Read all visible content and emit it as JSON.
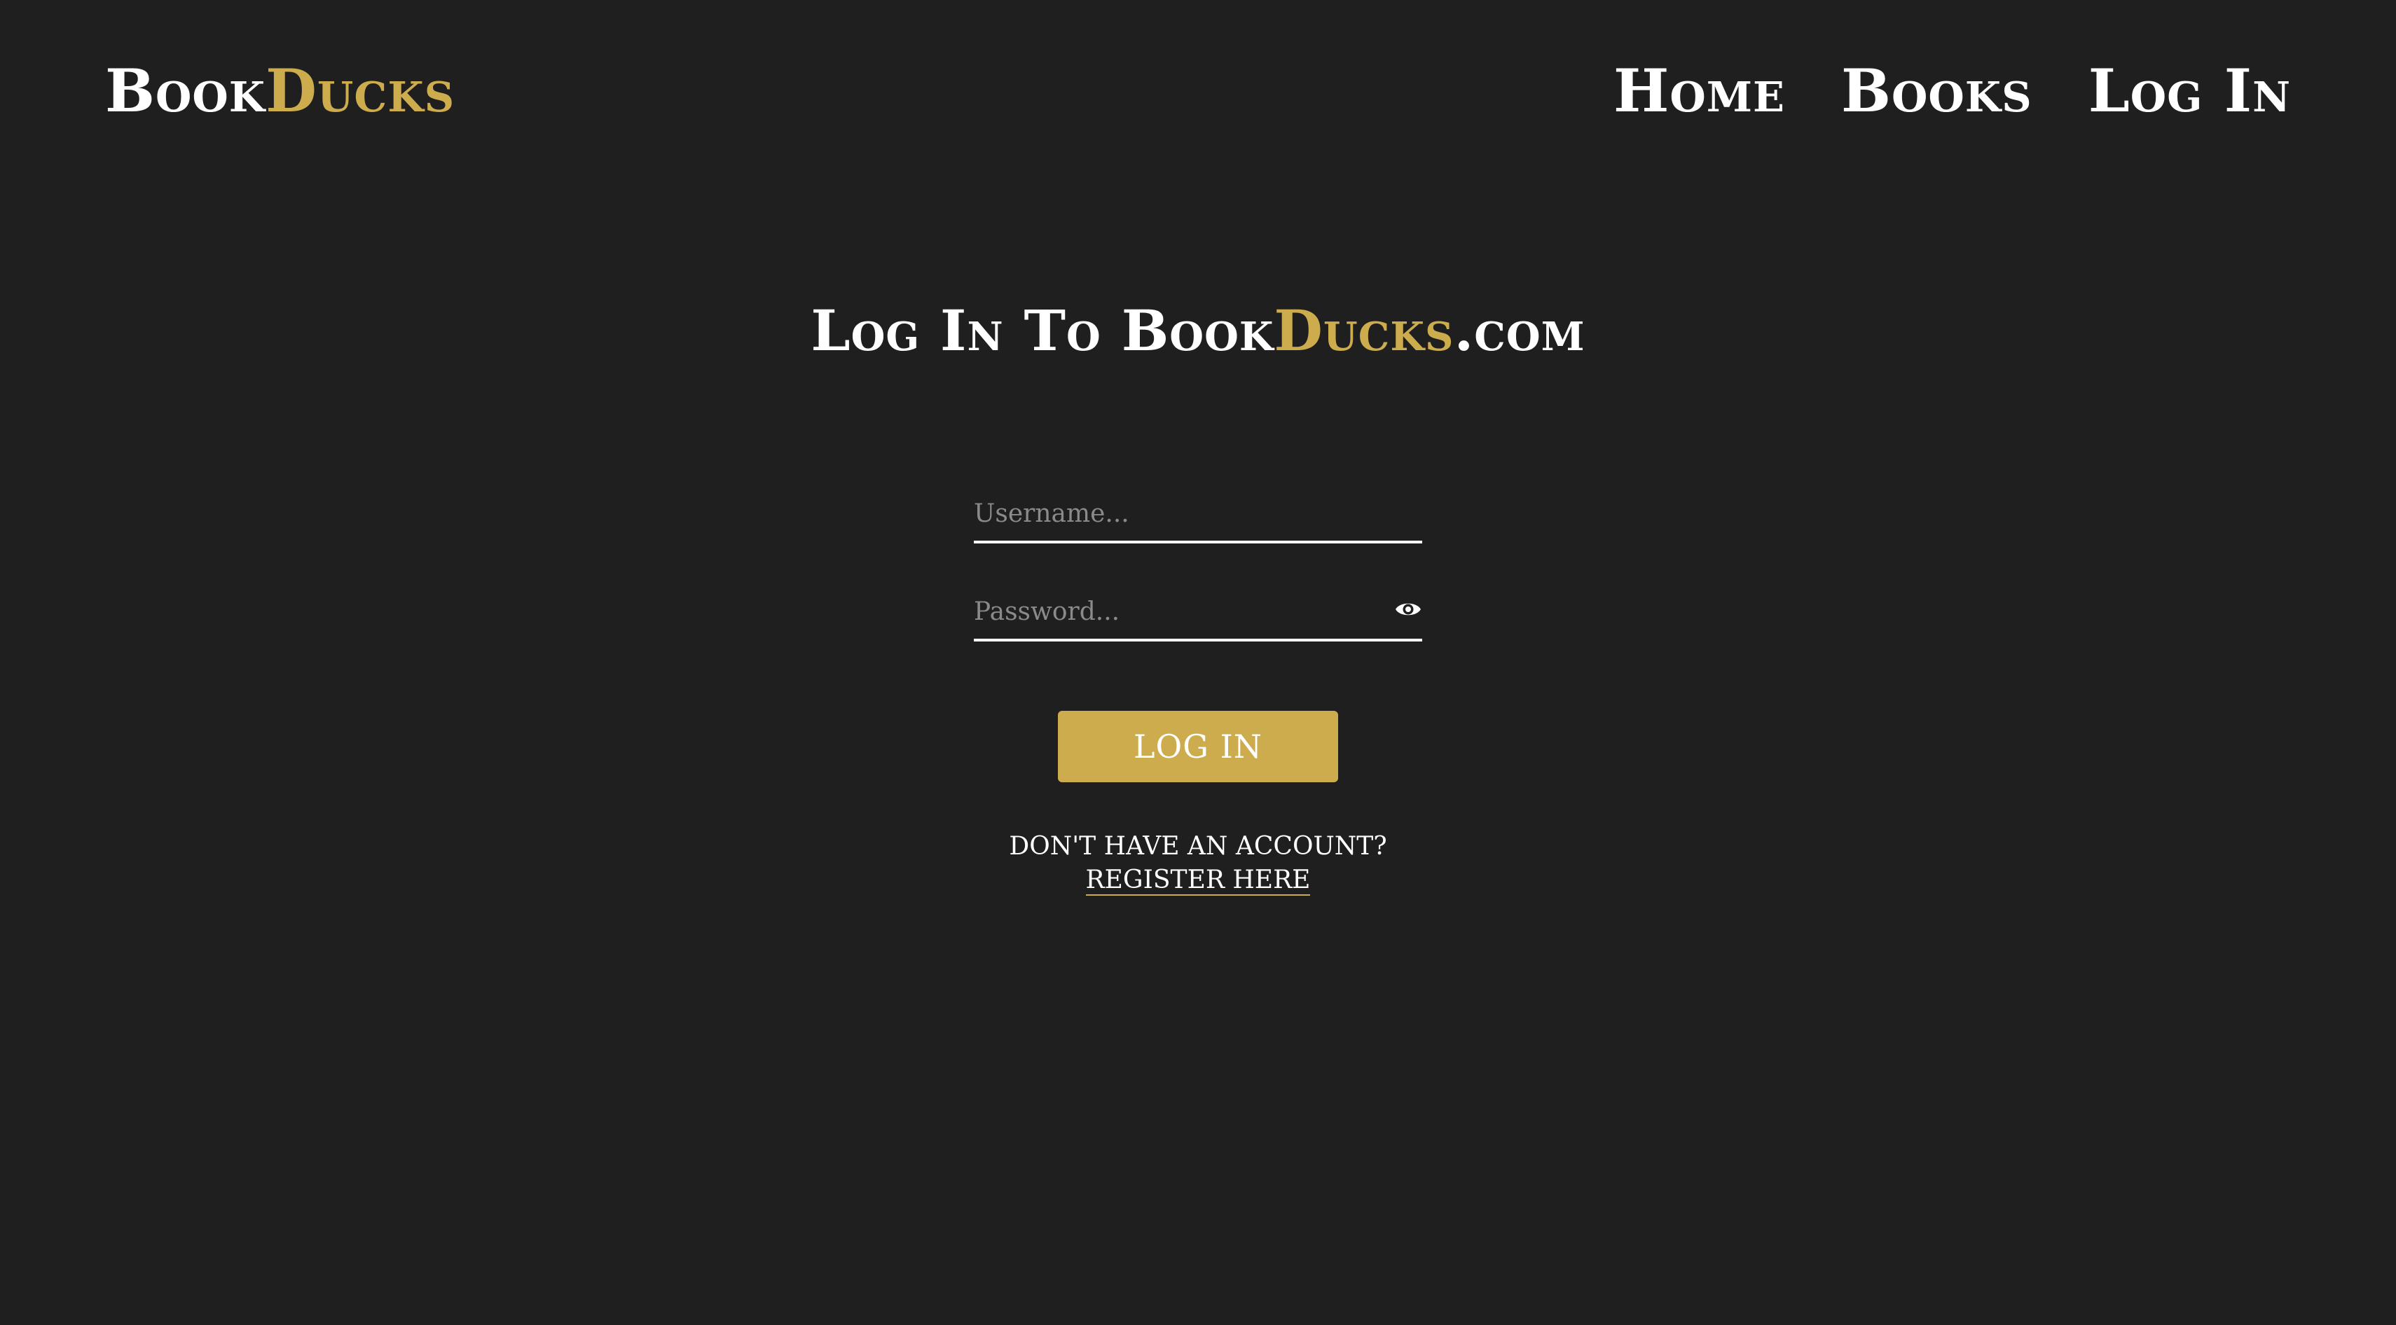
{
  "brand": {
    "part1": "Book",
    "part2": "Ducks"
  },
  "nav": {
    "home": "Home",
    "books": "Books",
    "login": "Log In"
  },
  "page": {
    "title_prefix": "Log In To ",
    "title_brand1": "Book",
    "title_brand2": "Ducks",
    "title_suffix": ".com"
  },
  "form": {
    "username_placeholder": "Username...",
    "password_placeholder": "Password...",
    "username_value": "",
    "password_value": "",
    "login_button": "LOG IN",
    "no_account_text": "DON'T HAVE AN ACCOUNT?",
    "register_link": "REGISTER HERE"
  },
  "icons": {
    "password_toggle": "eye-icon"
  },
  "colors": {
    "background": "#1f1f1f",
    "accent": "#cdac4d",
    "text": "#ffffff"
  }
}
